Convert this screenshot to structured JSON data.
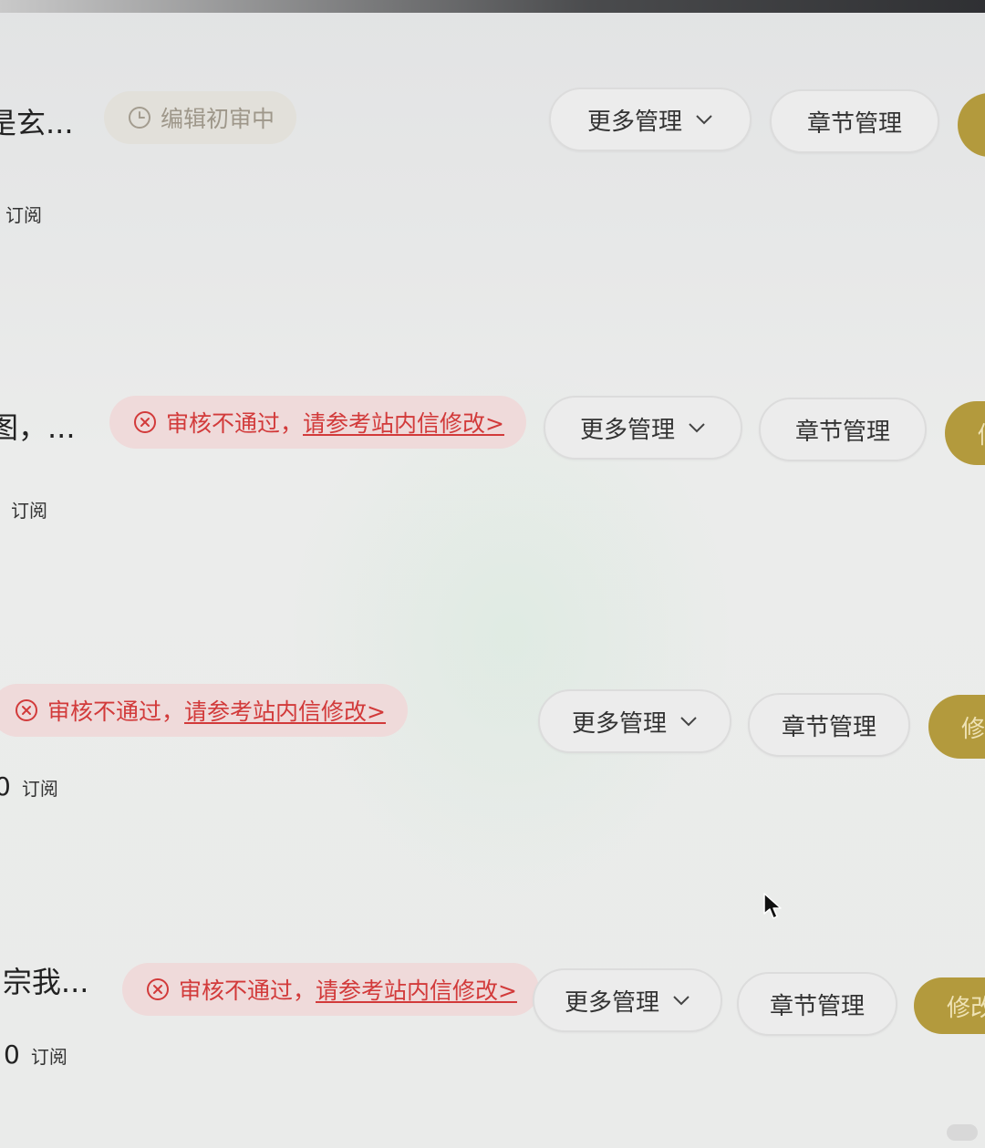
{
  "rows": [
    {
      "title": "是玄...",
      "status": {
        "type": "review",
        "text": "编辑初审中",
        "link": ""
      },
      "count": "",
      "subscribe_label": "订阅",
      "more_label": "更多管理",
      "chapter_label": "章节管理",
      "primary_label": ""
    },
    {
      "title": "图，...",
      "status": {
        "type": "fail",
        "text": "审核不通过，",
        "link": "请参考站内信修改>"
      },
      "count": "",
      "subscribe_label": "订阅",
      "more_label": "更多管理",
      "chapter_label": "章节管理",
      "primary_label": "修"
    },
    {
      "title": "",
      "status": {
        "type": "fail",
        "text": "审核不通过，",
        "link": "请参考站内信修改>"
      },
      "count": "0",
      "subscribe_label": "订阅",
      "more_label": "更多管理",
      "chapter_label": "章节管理",
      "primary_label": "修"
    },
    {
      "title": "l宗我...",
      "status": {
        "type": "fail",
        "text": "审核不通过，",
        "link": "请参考站内信修改>"
      },
      "count": "0",
      "subscribe_label": "订阅",
      "more_label": "更多管理",
      "chapter_label": "章节管理",
      "primary_label": "修改"
    }
  ],
  "icons": {
    "review": "clock-icon",
    "fail": "close-circle-icon",
    "dropdown": "chevron-down-icon",
    "cursor": "mouse-pointer-icon"
  },
  "colors": {
    "accent": "#b39a3d",
    "error": "#d23a3a",
    "review_text": "#9e978a"
  }
}
